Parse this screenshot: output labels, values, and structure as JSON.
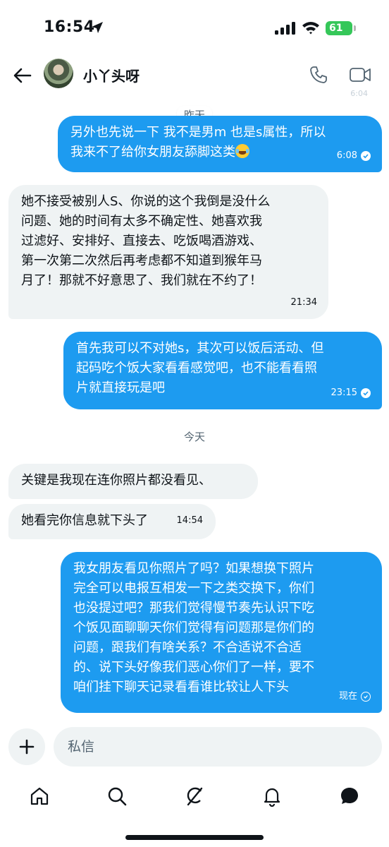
{
  "status_bar": {
    "time": "16:54",
    "battery": "61"
  },
  "header": {
    "contact_name": "小丫头呀",
    "truncated_time": "6:04"
  },
  "composer": {
    "placeholder": "私信"
  },
  "messages": [
    {
      "type": "date",
      "text": "昨天"
    },
    {
      "type": "out",
      "text": "另外也先说一下 我不是男m 也是s属性，所以\n我来不了给你女朋友舔脚这类",
      "emoji": "joy",
      "time": "6:08"
    },
    {
      "type": "in",
      "text": "她不接受被别人S、你说的这个我倒是没什么\n问题、她的时间有太多不确定性、她喜欢我\n过滤好、安排好、直接去、吃饭喝酒游戏、\n第一次第二次然后再考虑都不知道到猴年马\n月了！那就不好意思了、我们就在不约了！",
      "time": "21:34"
    },
    {
      "type": "out",
      "text": "首先我可以不对她s，其次可以饭后活动、但\n起码吃个饭大家看看感觉吧，也不能看看照\n片就直接玩是吧",
      "time": "23:15"
    },
    {
      "type": "date",
      "text": "今天"
    },
    {
      "type": "in",
      "text": "关键是我现在连你照片都没看见、"
    },
    {
      "type": "in",
      "text": "她看完你信息就下头了",
      "time": "14:54"
    },
    {
      "type": "out",
      "text": "我女朋友看见你照片了吗？如果想换下照片\n完全可以电报互相发一下之类交换下，你们\n也没提过吧？那我们觉得慢节奏先认识下吃\n个饭见面聊聊天你们觉得有问题那是你们的\n问题，跟我们有啥关系？不合适说不合适\n的、说下头好像我们恶心你们了一样，要不\n咱们挂下聊天记录看看谁比较让人下头",
      "time": "现在"
    }
  ],
  "nav": [
    "home-icon",
    "search-icon",
    "grok-icon",
    "notifications-icon",
    "messages-icon"
  ]
}
